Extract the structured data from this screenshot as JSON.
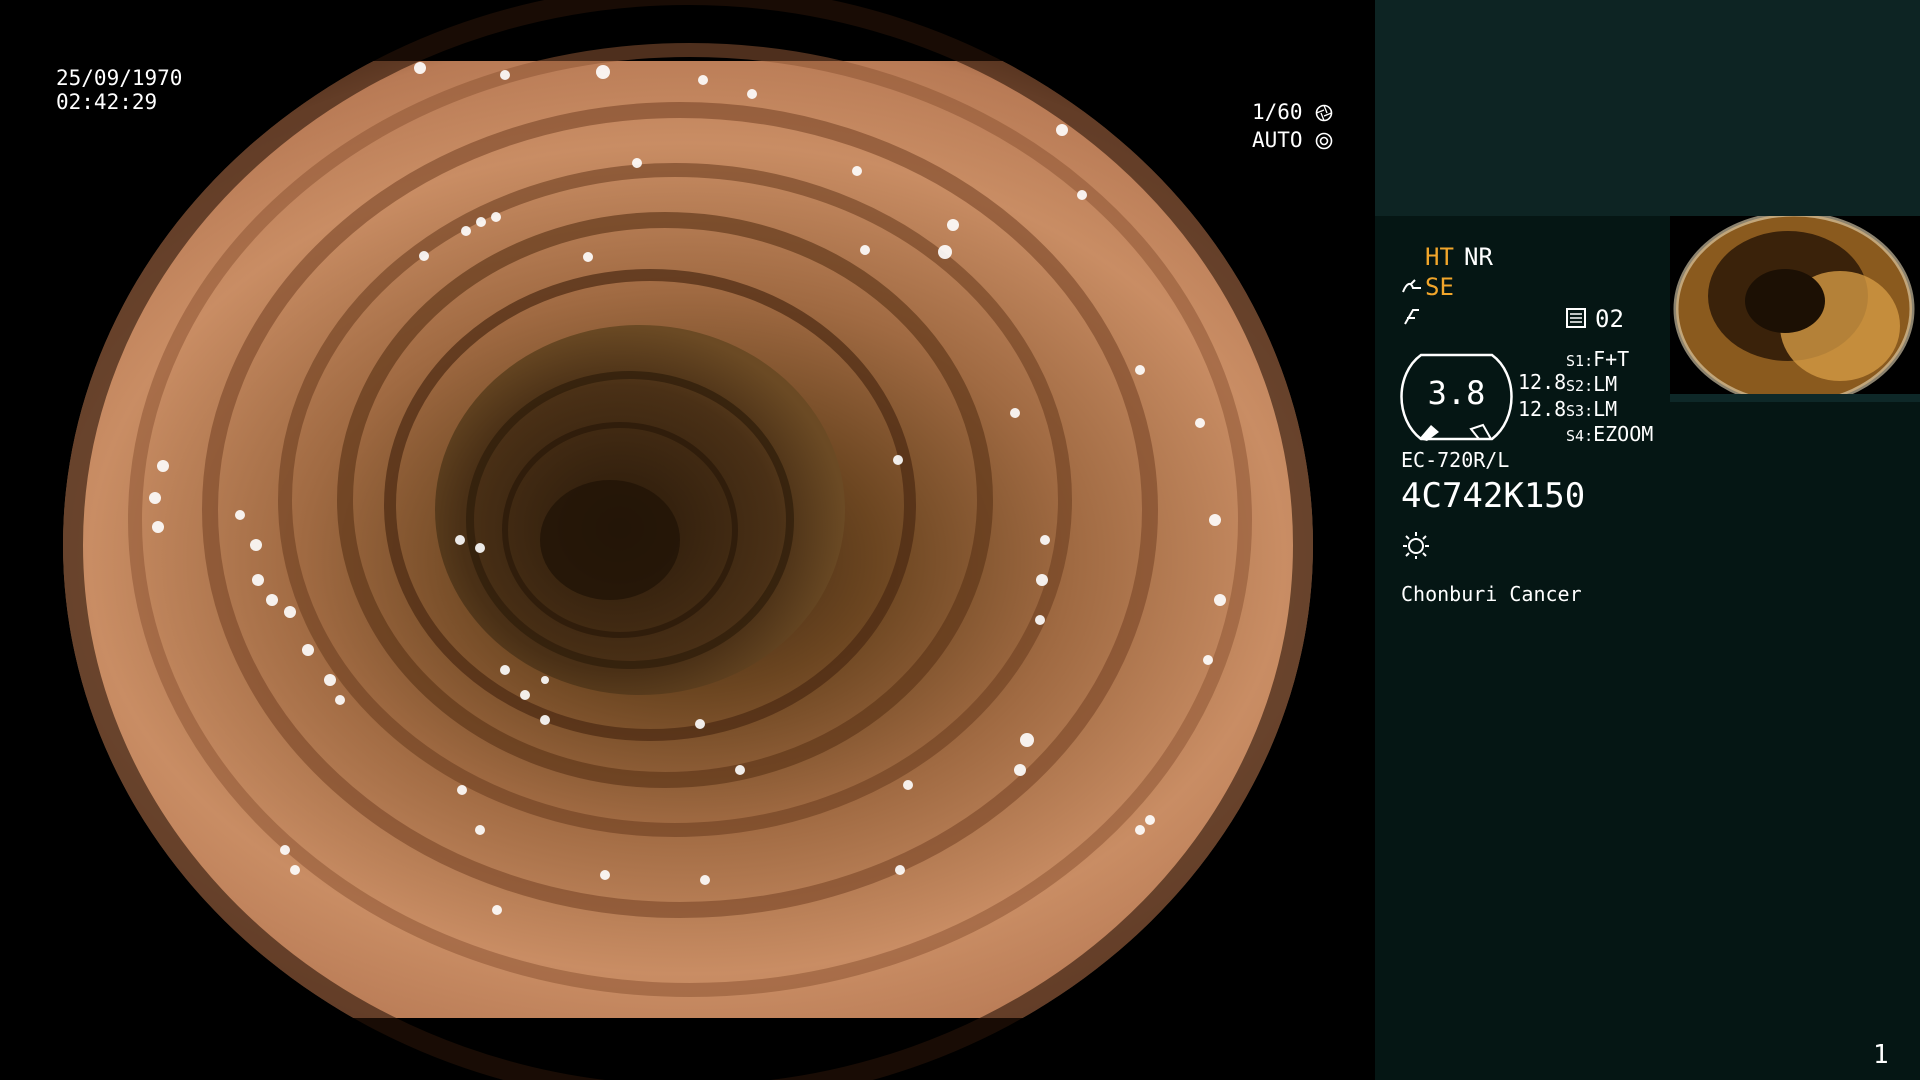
{
  "scope_display": {
    "date": "25/09/1970",
    "time": "02:42:29",
    "shutter": "1/60",
    "iris_mode": "AUTO",
    "shutter_icon": "aperture-icon",
    "iris_icon": "iris-icon"
  },
  "side_panel": {
    "mode_ht": "HT",
    "mode_nr": "NR",
    "mode_se": "SE",
    "record_icon": "memo-icon",
    "record_number": "02",
    "gauge_value": "3.8",
    "gauge_side_value_1": "12.8",
    "gauge_side_value_2": "12.8",
    "switches": [
      {
        "key": "S1",
        "value": "F+T"
      },
      {
        "key": "S2",
        "value": "LM"
      },
      {
        "key": "S3",
        "value": "LM"
      },
      {
        "key": "S4",
        "value": "EZOOM"
      }
    ],
    "scope_model": "EC-720R/L",
    "serial_number": "4C742K150",
    "light_icon": "sun-icon",
    "institution": "Chonburi Cancer",
    "page_number": "1"
  },
  "colors": {
    "panel_bg": "#051614",
    "panel_top_bg": "#0d2423",
    "accent_orange": "#f2a62b",
    "text": "#ffffff"
  }
}
